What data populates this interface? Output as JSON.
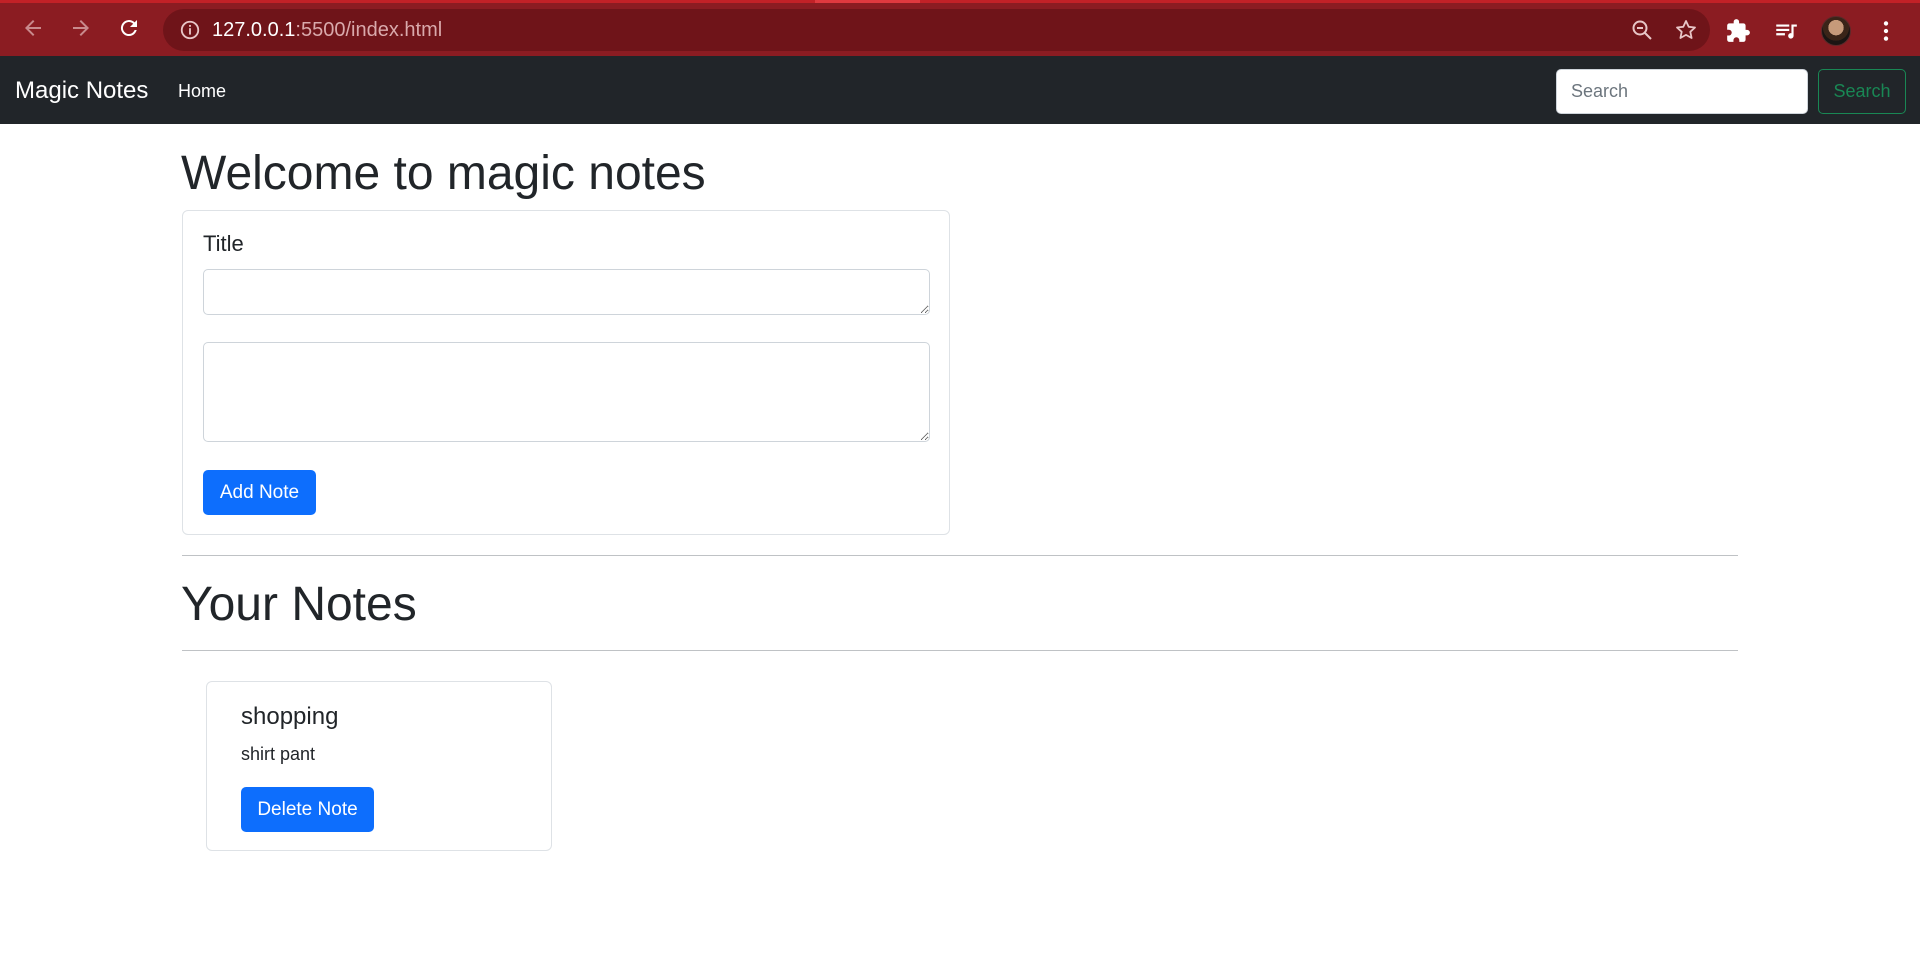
{
  "browser": {
    "url_host": "127.0.0.1",
    "url_rest": ":5500/index.html",
    "accent_color": "#8b1c22",
    "icons": [
      "back-icon",
      "forward-icon",
      "reload-icon",
      "info-icon",
      "zoom-out-icon",
      "star-icon",
      "extensions-icon",
      "media-queue-icon",
      "avatar",
      "menu-icon"
    ]
  },
  "navbar": {
    "brand": "Magic Notes",
    "home_link": "Home",
    "search_placeholder": "Search",
    "search_button": "Search"
  },
  "main": {
    "heading": "Welcome to magic notes",
    "form": {
      "title_label": "Title",
      "title_value": "",
      "body_value": "",
      "add_button": "Add Note"
    },
    "notes_heading": "Your Notes",
    "notes": [
      {
        "title": "shopping",
        "text": "shirt pant",
        "delete_button": "Delete Note"
      }
    ]
  },
  "colors": {
    "navbar_bg": "#212529",
    "primary": "#0d6efd",
    "success": "#198754"
  }
}
